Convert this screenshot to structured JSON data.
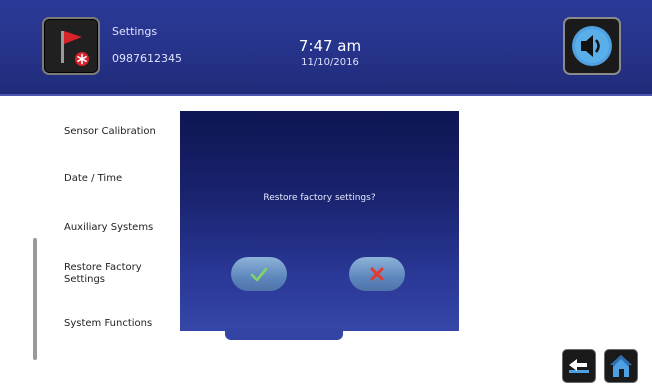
{
  "header": {
    "title": "Settings",
    "phone": "0987612345",
    "time": "7:47 am",
    "date": "11/10/2016"
  },
  "menu": {
    "items": [
      {
        "label": "Sensor Calibration"
      },
      {
        "label": "Date / Time"
      },
      {
        "label": "Auxiliary Systems"
      },
      {
        "label": "Restore Factory Settings"
      },
      {
        "label": "System Functions"
      }
    ]
  },
  "dialog": {
    "message": "Restore factory settings?",
    "confirm_icon": "checkmark-icon",
    "cancel_icon": "x-icon"
  },
  "nav": {
    "back_icon": "back-arrow-icon",
    "home_icon": "home-icon"
  },
  "colors": {
    "header": "#26338a",
    "dialog": "#1a2470",
    "pill": "#5e87bd",
    "checkmark": "#7fd36b",
    "cancel": "#e23a2e",
    "flag": "#d8232a"
  }
}
